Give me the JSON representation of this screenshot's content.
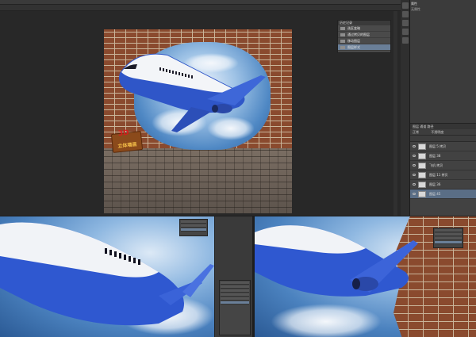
{
  "top": {
    "history_panel": {
      "title": "历史记录",
      "items": [
        {
          "label": "选区变暗"
        },
        {
          "label": "通过拷贝的图层"
        },
        {
          "label": "移动图层"
        },
        {
          "label": "图层样式",
          "selected": true
        }
      ]
    },
    "properties": {
      "title": "属性",
      "subtitle": "无属性"
    },
    "layers_panel": {
      "tabs": "图层  通道  路径",
      "mode": "正常",
      "opacity": "不透明度",
      "layers": [
        {
          "name": "图层 5 拷贝"
        },
        {
          "name": "图层 38"
        },
        {
          "name": "飞机 拷贝"
        },
        {
          "name": "图层 11 拷贝"
        },
        {
          "name": "图层 36"
        },
        {
          "name": "图层 45"
        }
      ]
    },
    "sign": {
      "label_3d": "3D",
      "label": "立体墙画"
    }
  }
}
